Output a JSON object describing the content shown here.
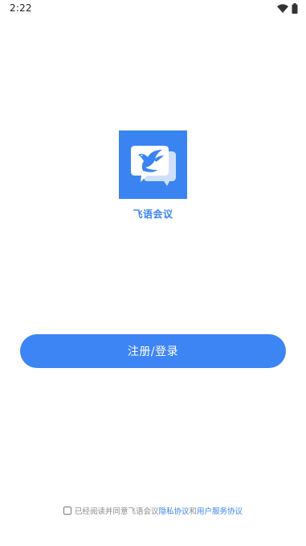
{
  "status_bar": {
    "time": "2:22",
    "icons": [
      "wifi-icon",
      "battery-icon"
    ]
  },
  "app": {
    "name": "飞语会议",
    "logo_icon": "bird-chat-bubble-logo",
    "brand_color": "#3a84f2"
  },
  "login": {
    "button_label": "注册/登录",
    "button_color": "#3d85f5"
  },
  "agreement": {
    "checked": false,
    "prefix": "已经阅读并同意飞语会议",
    "privacy_link": "隐私协议",
    "conjunction": "和",
    "terms_link": "用户服务协议"
  }
}
